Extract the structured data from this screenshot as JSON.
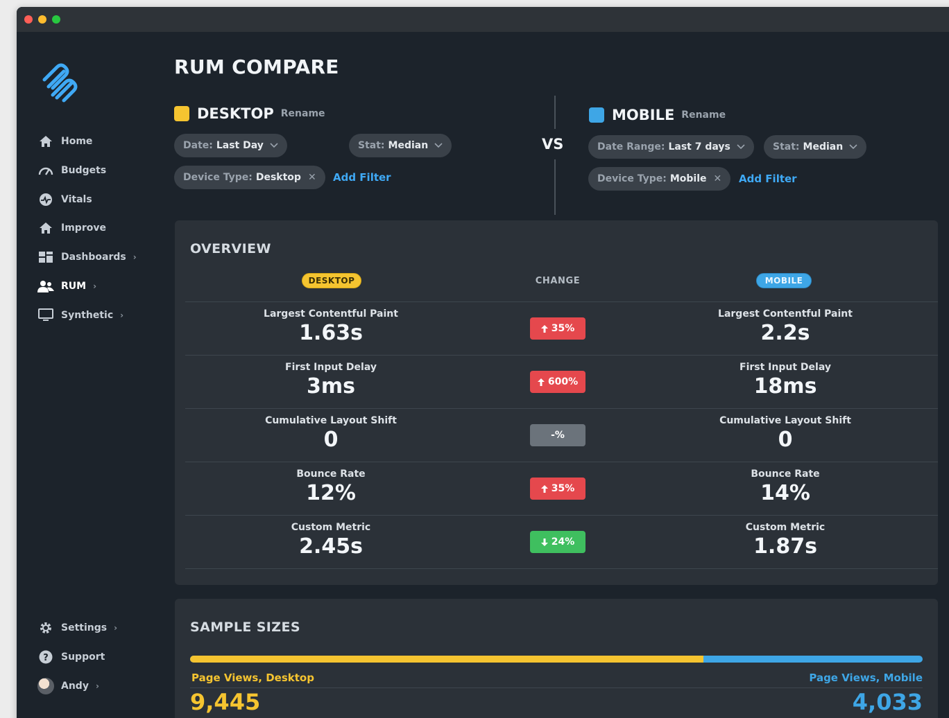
{
  "app": {
    "page_title": "RUM COMPARE"
  },
  "sidebar": {
    "items": [
      {
        "label": "Home",
        "icon": "home-icon"
      },
      {
        "label": "Budgets",
        "icon": "speedometer-icon"
      },
      {
        "label": "Vitals",
        "icon": "pulse-icon"
      },
      {
        "label": "Improve",
        "icon": "home-icon"
      },
      {
        "label": "Dashboards",
        "icon": "dashboard-icon",
        "chevron": "›"
      },
      {
        "label": "RUM",
        "icon": "users-icon",
        "chevron": "›",
        "active": true
      },
      {
        "label": "Synthetic",
        "icon": "monitor-icon",
        "chevron": "›"
      }
    ],
    "bottom_items": [
      {
        "label": "Settings",
        "icon": "gear-icon",
        "chevron": "›"
      },
      {
        "label": "Support",
        "icon": "help-icon"
      },
      {
        "label": "Andy",
        "icon": "avatar",
        "chevron": "›"
      }
    ]
  },
  "segments": {
    "left": {
      "name": "DESKTOP",
      "rename": "Rename",
      "color": "#f5c430",
      "filters": [
        {
          "key": "Date:",
          "value": "Last Day",
          "type": "dropdown"
        },
        {
          "key": "Stat:",
          "value": "Median",
          "type": "dropdown"
        },
        {
          "key": "Device Type:",
          "value": "Desktop",
          "type": "removable"
        }
      ],
      "add_filter": "Add Filter"
    },
    "vs": "VS",
    "right": {
      "name": "MOBILE",
      "rename": "Rename",
      "color": "#3ea6e6",
      "filters": [
        {
          "key": "Date Range:",
          "value": "Last 7 days",
          "type": "dropdown"
        },
        {
          "key": "Stat:",
          "value": "Median",
          "type": "dropdown"
        },
        {
          "key": "Device Type:",
          "value": "Mobile",
          "type": "removable"
        }
      ],
      "add_filter": "Add Filter"
    }
  },
  "overview": {
    "title": "OVERVIEW",
    "left_badge": "DESKTOP",
    "change_header": "CHANGE",
    "right_badge": "MOBILE",
    "rows": [
      {
        "metric": "Largest Contentful Paint",
        "left": "1.63s",
        "change": "35%",
        "direction": "up",
        "color": "#e5484d",
        "right": "2.2s"
      },
      {
        "metric": "First Input Delay",
        "left": "3ms",
        "change": "600%",
        "direction": "up",
        "color": "#e5484d",
        "right": "18ms"
      },
      {
        "metric": "Cumulative Layout Shift",
        "left": "0",
        "change": "-%",
        "direction": "none",
        "color": "#6b737b",
        "right": "0"
      },
      {
        "metric": "Bounce Rate",
        "left": "12%",
        "change": "35%",
        "direction": "up",
        "color": "#e5484d",
        "right": "14%"
      },
      {
        "metric": "Custom Metric",
        "left": "2.45s",
        "change": "24%",
        "direction": "down",
        "color": "#3fbf5f",
        "right": "1.87s"
      }
    ]
  },
  "sample_sizes": {
    "title": "SAMPLE SIZES",
    "left_label": "Page Views, Desktop",
    "left_value": "9,445",
    "right_label": "Page Views, Mobile",
    "right_value": "4,033",
    "left_share": 0.7008
  }
}
